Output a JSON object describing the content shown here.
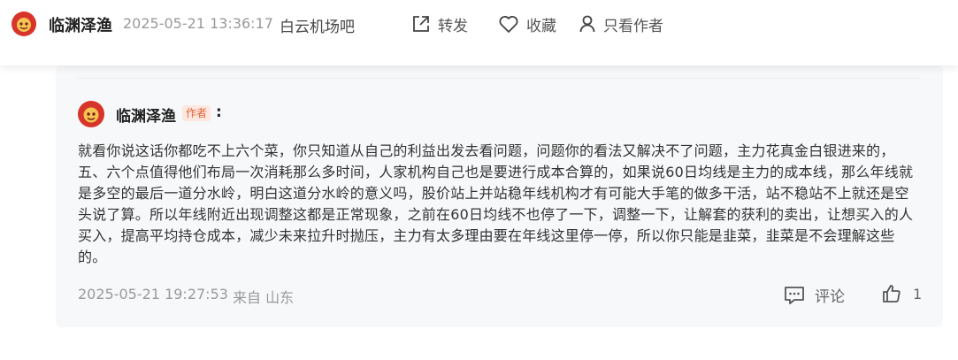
{
  "header": {
    "author": "临渊泽渔",
    "time": "2025-05-21 13:36:17",
    "forum": "白云机场吧",
    "actions": {
      "share": "转发",
      "favorite": "收藏",
      "only_author": "只看作者"
    }
  },
  "reply": {
    "author": "临渊泽渔",
    "badge": "作者",
    "colon": ":",
    "text": "就看你说这话你都吃不上六个菜，你只知道从自己的利益出发去看问题，问题你的看法又解决不了问题，主力花真金白银进来的，五、六个点值得他们布局一次消耗那么多时间，人家机构自己也是要进行成本合算的，如果说60日均线是主力的成本线，那么年线就是多空的最后一道分水岭，明白这道分水岭的意义吗，股价站上并站稳年线机构才有可能大手笔的做多干活，站不稳站不上就还是空头说了算。所以年线附近出现调整这都是正常现象，之前在60日均线不也停了一下，调整一下，让解套的获利的卖出，让想买入的人买入，提高平均持仓成本，减少未来拉升时抛压，主力有太多理由要在年线这里停一停，所以你只能是韭菜，韭菜是不会理解这些的。",
    "time": "2025-05-21 19:27:53",
    "location": "来自 山东",
    "comment_label": "评论",
    "like_count": "1"
  },
  "icons": {
    "share": "share-icon",
    "favorite": "heart-icon",
    "only_author": "user-icon",
    "comment": "comment-icon",
    "like": "thumbs-up-icon"
  },
  "colors": {
    "badge_text": "#e2623a",
    "badge_bg": "#fde8df",
    "avatar_red": "#d8352a"
  }
}
